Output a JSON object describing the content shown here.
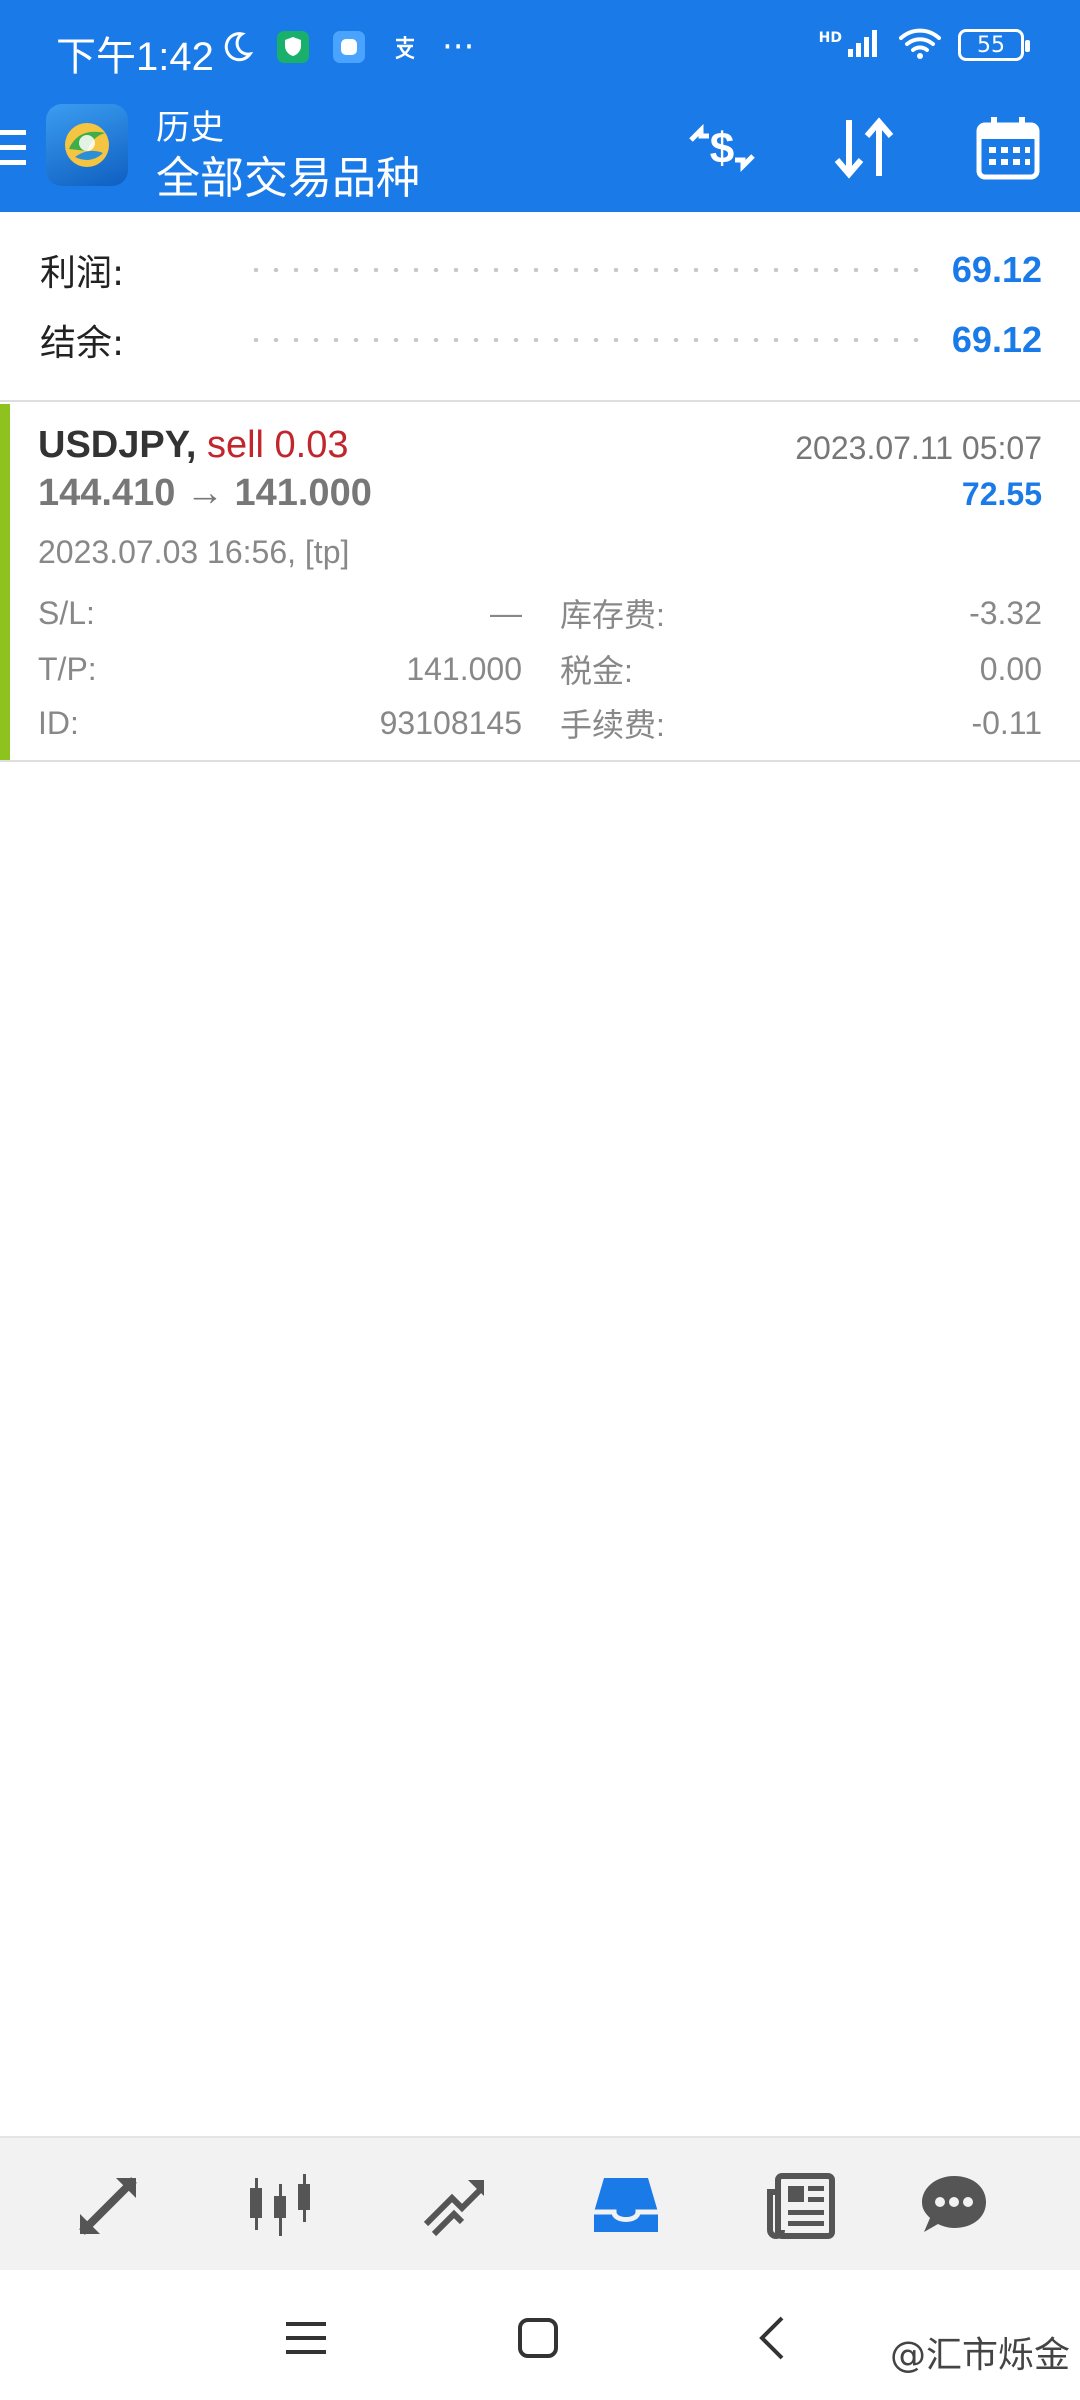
{
  "status_bar": {
    "time": "下午1:42",
    "battery": "55",
    "network": "HD",
    "overflow": "···"
  },
  "toolbar": {
    "title": "历史",
    "subtitle": "全部交易品种"
  },
  "summary": {
    "profit_label": "利润:",
    "profit_value": "69.12",
    "balance_label": "结余:",
    "balance_value": "69.12"
  },
  "deal": {
    "symbol": "USDJPY,",
    "type": "sell 0.03",
    "prices": "144.410 → 141.000",
    "close_time": "2023.07.11 05:07",
    "profit": "72.55",
    "open_info": "2023.07.03 16:56, [tp]",
    "sl_label": "S/L:",
    "sl_value": "—",
    "tp_label": "T/P:",
    "tp_value": "141.000",
    "id_label": "ID:",
    "id_value": "93108145",
    "swap_label": "库存费:",
    "swap_value": "-3.32",
    "tax_label": "税金:",
    "tax_value": "0.00",
    "commission_label": "手续费:",
    "commission_value": "-0.11"
  },
  "bottom_nav": {
    "items": [
      "quotes-icon",
      "chart-icon",
      "trade-icon",
      "history-icon",
      "news-icon",
      "chat-icon"
    ],
    "active": "history-icon"
  },
  "watermark": "@汇市烁金",
  "colors": {
    "header": "#1a7ae8",
    "accent": "#1a7ae8",
    "sell": "#c0262c",
    "deal_bar": "#8dc21f"
  }
}
